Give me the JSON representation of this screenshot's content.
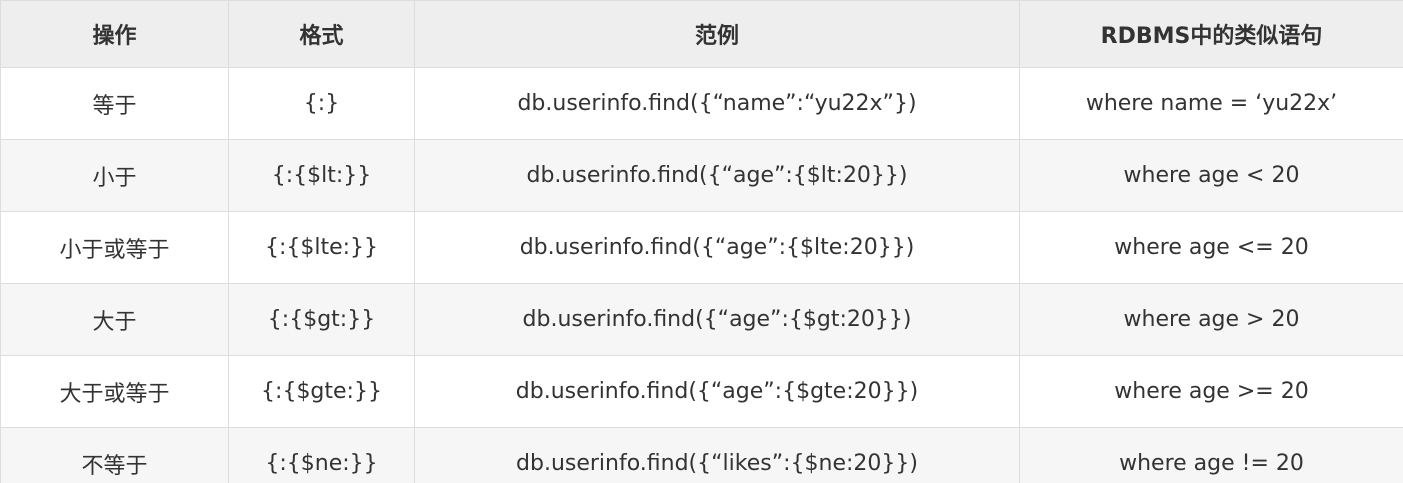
{
  "table": {
    "headers": [
      "操作",
      "格式",
      "范例",
      "RDBMS中的类似语句"
    ],
    "rows": [
      [
        "等于",
        "{:}",
        "db.userinfo.find({“name”:“yu22x”})",
        "where name = ‘yu22x’"
      ],
      [
        "小于",
        "{:{$lt:}}",
        "db.userinfo.find({“age”:{$lt:20}})",
        "where age < 20"
      ],
      [
        "小于或等于",
        "{:{$lte:}}",
        "db.userinfo.find({“age”:{$lte:20}})",
        "where age <= 20"
      ],
      [
        "大于",
        "{:{$gt:}}",
        "db.userinfo.find({“age”:{$gt:20}})",
        "where age > 20"
      ],
      [
        "大于或等于",
        "{:{$gte:}}",
        "db.userinfo.find({“age”:{$gte:20}})",
        "where age >= 20"
      ],
      [
        "不等于",
        "{:{$ne:}}",
        "db.userinfo.find({“likes”:{$ne:20}})",
        "where age != 20"
      ]
    ]
  },
  "colors": {
    "header_bg": "#eeeeee",
    "row_alt_bg": "#f6f6f6",
    "row_bg": "#ffffff",
    "border": "#dddddd",
    "text": "#333333"
  }
}
